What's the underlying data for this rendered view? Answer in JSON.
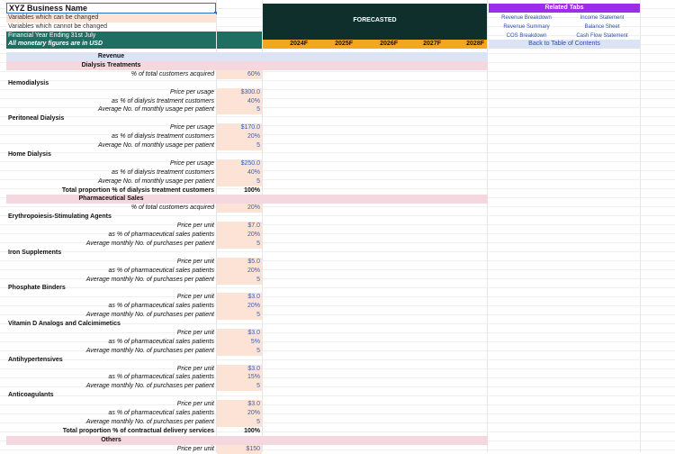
{
  "header": {
    "business_name": "XYZ Business Name",
    "legend_changeable": "Variables which can be changed",
    "legend_fixed": "Variables which cannot be changed",
    "fiscal_year": "Financial Year Ending 31st July",
    "currency_note": "All monetary figures are in USD",
    "forecasted_label": "FORECASTED",
    "years": [
      "2024F",
      "2025F",
      "2026F",
      "2027F",
      "2028F"
    ]
  },
  "related_tabs": {
    "title": "Related Tabs",
    "links": [
      "Revenue Breakdown",
      "Income Statement",
      "Revenue Summary",
      "Balance Sheet",
      "COS Breakdown",
      "Cash Flow Statement"
    ],
    "back": "Back to Table of Contents"
  },
  "rows": [
    {
      "type": "blue",
      "label": "Revenue"
    },
    {
      "type": "section",
      "label": "Dialysis Treatments"
    },
    {
      "type": "item",
      "label": "% of total customers acquired",
      "value": "60%",
      "style": "inp"
    },
    {
      "type": "head",
      "label": "Hemodialysis"
    },
    {
      "type": "item",
      "label": "Price per usage",
      "value": "$300.0",
      "style": "inp"
    },
    {
      "type": "item",
      "label": "as % of dialysis treatment customers",
      "value": "40%",
      "style": "inp"
    },
    {
      "type": "item",
      "label": "Average No. of monthly usage per patient",
      "value": "5",
      "style": "inp"
    },
    {
      "type": "head",
      "label": "Peritoneal Dialysis"
    },
    {
      "type": "item",
      "label": "Price per usage",
      "value": "$170.0",
      "style": "inp"
    },
    {
      "type": "item",
      "label": "as % of dialysis treatment customers",
      "value": "20%",
      "style": "inp"
    },
    {
      "type": "item",
      "label": "Average No. of monthly usage per patient",
      "value": "5",
      "style": "inp"
    },
    {
      "type": "head",
      "label": "Home Dialysis"
    },
    {
      "type": "item",
      "label": "Price per usage",
      "value": "$250.0",
      "style": "inp"
    },
    {
      "type": "item",
      "label": "as % of dialysis treatment customers",
      "value": "40%",
      "style": "inp"
    },
    {
      "type": "item",
      "label": "Average No. of monthly usage per patient",
      "value": "5",
      "style": "inp"
    },
    {
      "type": "total",
      "label": "Total proportion % of dialysis treatment customers",
      "value": "100%"
    },
    {
      "type": "section",
      "label": "Pharmaceutical Sales"
    },
    {
      "type": "item",
      "label": "% of total customers acquired",
      "value": "20%",
      "style": "inp"
    },
    {
      "type": "head",
      "label": "Erythropoiesis-Stimulating Agents"
    },
    {
      "type": "item",
      "label": "Price per unit",
      "value": "$7.0",
      "style": "inp"
    },
    {
      "type": "item",
      "label": "as % of pharmaceutical sales patients",
      "value": "20%",
      "style": "inp"
    },
    {
      "type": "item",
      "label": "Average monthly No. of purchases per patient",
      "value": "5",
      "style": "inp"
    },
    {
      "type": "head",
      "label": "Iron Supplements"
    },
    {
      "type": "item",
      "label": "Price per unit",
      "value": "$5.0",
      "style": "inp"
    },
    {
      "type": "item",
      "label": "as % of pharmaceutical sales patients",
      "value": "20%",
      "style": "inp"
    },
    {
      "type": "item",
      "label": "Average monthly No. of purchases per patient",
      "value": "5",
      "style": "inp"
    },
    {
      "type": "head",
      "label": "Phosphate Binders"
    },
    {
      "type": "item",
      "label": "Price per unit",
      "value": "$3.0",
      "style": "inp"
    },
    {
      "type": "item",
      "label": "as % of pharmaceutical sales patients",
      "value": "20%",
      "style": "inp"
    },
    {
      "type": "item",
      "label": "Average monthly No. of purchases per patient",
      "value": "5",
      "style": "inp"
    },
    {
      "type": "head",
      "label": "Vitamin D Analogs and Calcimimetics"
    },
    {
      "type": "item",
      "label": "Price per unit",
      "value": "$3.0",
      "style": "inp"
    },
    {
      "type": "item",
      "label": "as % of pharmaceutical sales patients",
      "value": "5%",
      "style": "inp"
    },
    {
      "type": "item",
      "label": "Average monthly No. of purchases per patient",
      "value": "5",
      "style": "inp"
    },
    {
      "type": "head",
      "label": "Antihypertensives"
    },
    {
      "type": "item",
      "label": "Price per unit",
      "value": "$3.0",
      "style": "inp"
    },
    {
      "type": "item",
      "label": "as % of pharmaceutical sales patients",
      "value": "15%",
      "style": "inp"
    },
    {
      "type": "item",
      "label": "Average monthly No. of purchases per patient",
      "value": "5",
      "style": "inp"
    },
    {
      "type": "head",
      "label": "Anticoagulants"
    },
    {
      "type": "item",
      "label": "Price per unit",
      "value": "$3.0",
      "style": "inp"
    },
    {
      "type": "item",
      "label": "as % of pharmaceutical sales patients",
      "value": "20%",
      "style": "inp"
    },
    {
      "type": "item",
      "label": "Average monthly No. of purchases per patient",
      "value": "5",
      "style": "inp"
    },
    {
      "type": "total",
      "label": "Total proportion % of contractual delivery services",
      "value": "100%"
    },
    {
      "type": "section",
      "label": "Others"
    },
    {
      "type": "item",
      "label": "Price per unit",
      "value": "$150",
      "style": "inp"
    }
  ],
  "colors": {
    "dark_header": "#0f2f2c",
    "teal": "#1f6e62",
    "orange": "#f4a623",
    "purple": "#9d2de8",
    "input_fill": "#fde3d6",
    "section_fill": "#f5d7e0",
    "blue_fill": "#dbe3f5"
  }
}
